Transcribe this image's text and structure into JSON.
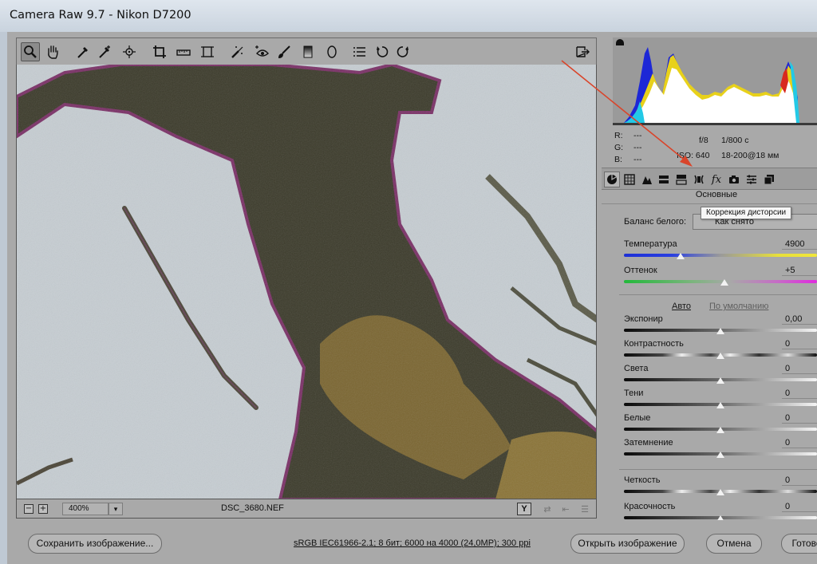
{
  "window": {
    "title": "Camera Raw 9.7  -  Nikon D7200"
  },
  "toolbar": {
    "tools": [
      "zoom-icon",
      "hand-icon",
      "white-balance-icon",
      "color-sampler-icon",
      "target-adjustment-icon",
      "crop-icon",
      "straighten-icon",
      "transform-icon",
      "spot-removal-icon",
      "red-eye-icon",
      "adjustment-brush-icon",
      "graduated-filter-icon",
      "radial-filter-icon",
      "preferences-icon",
      "rotate-left-icon",
      "rotate-right-icon"
    ],
    "fullscreen": "fullscreen-icon"
  },
  "preview": {
    "zoom": "400%",
    "filename": "DSC_3680.NEF",
    "zoom_out": "−",
    "zoom_in": "+"
  },
  "info": {
    "r_label": "R:",
    "r_value": "---",
    "g_label": "G:",
    "g_value": "---",
    "b_label": "B:",
    "b_value": "---",
    "aperture": "f/8",
    "shutter": "1/800 с",
    "iso": "ISO: 640",
    "lens": "18-200@18 мм"
  },
  "panel": {
    "title": "Основные",
    "tooltip": "Коррекция дисторсии",
    "wb_label": "Баланс белого:",
    "wb_value": "Как снято",
    "auto": "Авто",
    "default": "По умолчанию"
  },
  "sliders": [
    {
      "label": "Температура",
      "value": "4900",
      "level": 0.295
    },
    {
      "label": "Оттенок",
      "value": "+5",
      "level": 0.52
    },
    {
      "label": "Экспонир",
      "value": "0,00",
      "level": 0.5
    },
    {
      "label": "Контрастность",
      "value": "0",
      "level": 0.5
    },
    {
      "label": "Света",
      "value": "0",
      "level": 0.5
    },
    {
      "label": "Тени",
      "value": "0",
      "level": 0.5
    },
    {
      "label": "Белые",
      "value": "0",
      "level": 0.5
    },
    {
      "label": "Затемнение",
      "value": "0",
      "level": 0.5
    },
    {
      "label": "Четкость",
      "value": "0",
      "level": 0.5
    },
    {
      "label": "Красочность",
      "value": "0",
      "level": 0.5
    }
  ],
  "bottom": {
    "save": "Сохранить изображение...",
    "profile": "sRGB IEC61966-2.1; 8 бит; 6000 на 4000 (24,0MP); 300 ppi",
    "open": "Открыть изображение",
    "cancel": "Отмена",
    "done": "Готово"
  },
  "colors": {
    "accent_arrow": "#d9452b",
    "panel_bg": "#a9a9a9",
    "sky": "#c7ced3",
    "branch": "#3a3a28"
  }
}
